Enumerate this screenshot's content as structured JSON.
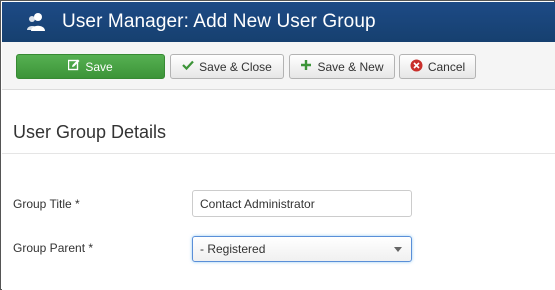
{
  "header": {
    "title": "User Manager: Add New User Group",
    "icon": "users-icon"
  },
  "toolbar": {
    "save_label": "Save",
    "save_close_label": "Save & Close",
    "save_new_label": "Save & New",
    "cancel_label": "Cancel"
  },
  "form": {
    "section_title": "User Group Details",
    "group_title_label": "Group Title *",
    "group_title_value": "Contact Administrator",
    "group_parent_label": "Group Parent *",
    "group_parent_value": "- Registered"
  },
  "colors": {
    "header_bg": "#1d4a86",
    "save_green": "#4aa346",
    "cancel_red": "#c9302c"
  }
}
